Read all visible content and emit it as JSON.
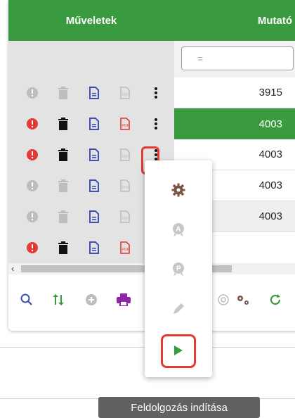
{
  "header": {
    "actions_label": "Műveletek",
    "indicator_label": "Mutató"
  },
  "filter": {
    "operator": "="
  },
  "rows": [
    {
      "value": "3915",
      "selected": false,
      "active": false
    },
    {
      "value": "4003",
      "selected": true,
      "active": true
    },
    {
      "value": "4003",
      "selected": false,
      "active": true
    },
    {
      "value": "4003",
      "selected": false,
      "active": false
    },
    {
      "value": "4003",
      "selected": false,
      "active": false
    },
    {
      "value": "",
      "selected": false,
      "active": true
    }
  ],
  "row_icons": [
    "info-icon",
    "trash-icon",
    "document-icon",
    "pdf-icon",
    "more-vertical-icon"
  ],
  "toolbar_icons": [
    "search-icon",
    "swap-icon",
    "add-circle-icon",
    "print-icon",
    "at-icon",
    "settings-gears-icon",
    "refresh-icon"
  ],
  "dropdown_icons": [
    "gear-icon",
    "badge-a-icon",
    "badge-p-icon",
    "pen-icon",
    "play-icon"
  ],
  "tooltip": {
    "text": "Feldolgozás indítása"
  },
  "colors": {
    "green": "#3a9a3f",
    "red": "#e53935",
    "blue": "#3f51b5",
    "purple": "#8e24aa",
    "brown": "#795548"
  }
}
